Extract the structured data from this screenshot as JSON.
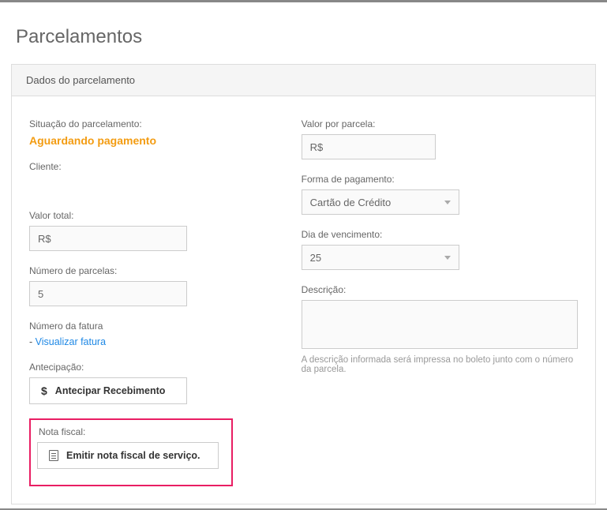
{
  "page": {
    "title": "Parcelamentos",
    "panel_header": "Dados do parcelamento"
  },
  "left": {
    "status_label": "Situação do parcelamento:",
    "status_value": "Aguardando pagamento",
    "client_label": "Cliente:",
    "total_label": "Valor total:",
    "total_prefix": "R$",
    "total_value": "",
    "num_parcelas_label": "Número de parcelas:",
    "num_parcelas_value": "5",
    "invoice_label": "Número da fatura",
    "invoice_prefix": " - ",
    "invoice_link": "Visualizar fatura",
    "antecipacao_label": "Antecipação:",
    "antecipar_btn": "Antecipar Recebimento",
    "nota_fiscal_label": "Nota fiscal:",
    "emitir_btn": "Emitir nota fiscal de serviço."
  },
  "right": {
    "valor_parcela_label": "Valor por parcela:",
    "valor_parcela_prefix": "R$",
    "valor_parcela_value": "",
    "forma_pagamento_label": "Forma de pagamento:",
    "forma_pagamento_value": "Cartão de Crédito",
    "dia_venc_label": "Dia de vencimento:",
    "dia_venc_value": "25",
    "descricao_label": "Descrição:",
    "descricao_help": "A descrição informada será impressa no boleto junto com o número da parcela."
  }
}
